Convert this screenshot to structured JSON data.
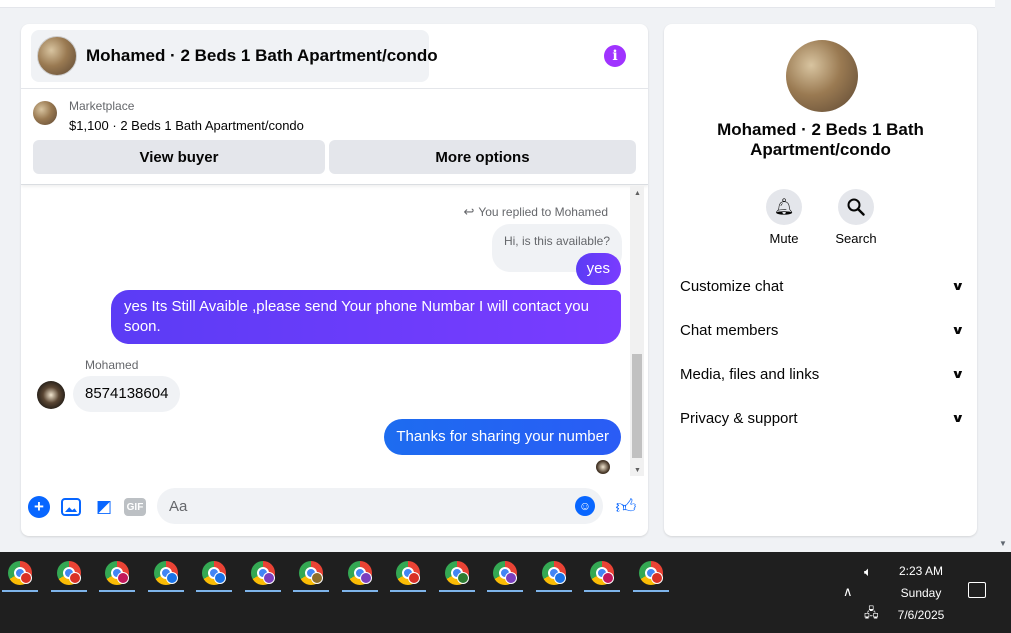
{
  "header": {
    "title": "Mohamed · 2 Beds 1 Bath Apartment/condo",
    "info_icon": "info-icon"
  },
  "listing": {
    "source": "Marketplace",
    "summary": "$1,100 · 2 Beds 1 Bath Apartment/condo",
    "view_buyer_label": "View buyer",
    "more_options_label": "More options"
  },
  "messages": {
    "replied_note": "You replied to Mohamed",
    "quoted_text": "Hi, is this available?",
    "reply_yes": "yes",
    "reply_long": "yes Its Still Avaible ,please send Your phone Numbar I will contact you soon.",
    "sender_name": "Mohamed",
    "incoming_phone": "8574138604",
    "reply_thanks": "Thanks for sharing your number"
  },
  "composer": {
    "placeholder": "Aa",
    "gif_label": "GIF"
  },
  "side_panel": {
    "name": "Mohamed · 2 Beds 1 Bath Apartment/condo",
    "mute_label": "Mute",
    "search_label": "Search",
    "menu": [
      {
        "label": "Customize chat"
      },
      {
        "label": "Chat members"
      },
      {
        "label": "Media, files and links"
      },
      {
        "label": "Privacy & support"
      }
    ]
  },
  "taskbar": {
    "app_count": 14,
    "app_icon": "chrome-icon",
    "profile_colors": [
      "#d93025",
      "#d93025",
      "#c2185b",
      "#1a73e8",
      "#1a73e8",
      "#7b3fbf",
      "#8d6e2a",
      "#7b3fbf",
      "#d93025",
      "#2e7d32",
      "#7b3fbf",
      "#1a73e8",
      "#c2185b",
      "#d93025"
    ],
    "time": "2:23 AM",
    "day": "Sunday",
    "date": "7/6/2025"
  },
  "colors": {
    "accent_blue": "#0866ff",
    "bubble_purple": "#6b3cf8",
    "info_purple": "#a033ff",
    "panel_bg": "#f0f2f5"
  }
}
